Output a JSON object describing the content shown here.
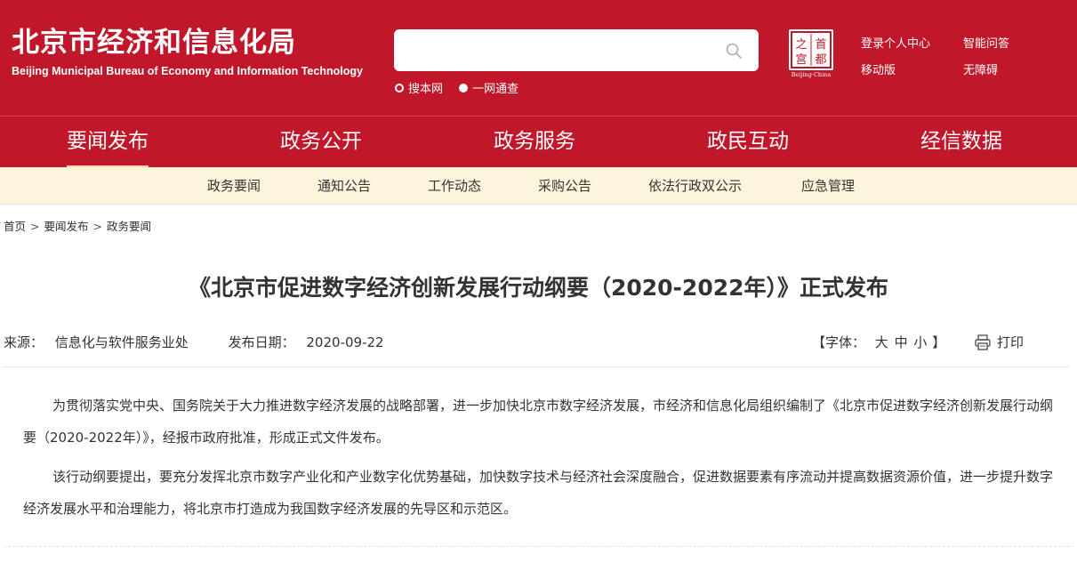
{
  "header": {
    "logo_cn": "北京市经济和信息化局",
    "logo_en": "Beijing Municipal Bureau of Economy and Information Technology",
    "search": {
      "value": "",
      "placeholder": ""
    },
    "search_scopes": [
      "搜本网",
      "一网通查"
    ],
    "seal": {
      "chars": [
        "之",
        "首",
        "宫",
        "都"
      ],
      "caption": "Beijing·China"
    },
    "links": {
      "login": "登录个人中心",
      "qa": "智能问答",
      "mobile": "移动版",
      "accessible": "无障碍"
    }
  },
  "nav": {
    "items": [
      "要闻发布",
      "政务公开",
      "政务服务",
      "政民互动",
      "经信数据"
    ],
    "active_index": 0
  },
  "subnav": {
    "items": [
      "政务要闻",
      "通知公告",
      "工作动态",
      "采购公告",
      "依法行政双公示",
      "应急管理"
    ]
  },
  "breadcrumb": [
    "首页",
    "要闻发布",
    "政务要闻"
  ],
  "breadcrumb_sep": ">",
  "article": {
    "title": "《北京市促进数字经济创新发展行动纲要（2020-2022年）》正式发布",
    "source_label": "来源：",
    "source": "信息化与软件服务业处",
    "date_label": "发布日期：",
    "date": "2020-09-22",
    "font_label_open": "【字体：",
    "font_sizes": [
      "大",
      "中",
      "小"
    ],
    "font_label_close": "】",
    "print_label": "打印",
    "paragraphs": [
      "为贯彻落实党中央、国务院关于大力推进数字经济发展的战略部署，进一步加快北京市数字经济发展，市经济和信息化局组织编制了《北京市促进数字经济创新发展行动纲要（2020-2022年）》，经报市政府批准，形成正式文件发布。",
      "该行动纲要提出，要充分发挥北京市数字产业化和产业数字化优势基础，加快数字技术与经济社会深度融合，促进数据要素有序流动并提高数据资源价值，进一步提升数字经济发展水平和治理能力，将北京市打造成为我国数字经济发展的先导区和示范区。"
    ]
  },
  "colors": {
    "brand_red": "#c0172a",
    "subnav_bg": "#fdf4dc",
    "text": "#333333"
  }
}
